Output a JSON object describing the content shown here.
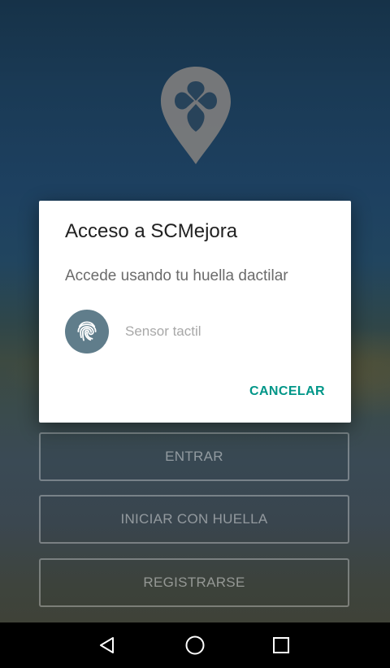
{
  "app": {
    "logo_icon": "location-pin-flower-icon"
  },
  "dialog": {
    "title": "Acceso a SCMejora",
    "description": "Accede usando tu huella dactilar",
    "sensor_icon": "fingerprint-icon",
    "sensor_label": "Sensor tactil",
    "cancel_label": "CANCELAR",
    "accent_color": "#009688",
    "icon_bg_color": "#607d8b"
  },
  "buttons": {
    "enter_label": "ENTRAR",
    "fingerprint_login_label": "INICIAR CON HUELLA",
    "register_label": "REGISTRARSE"
  },
  "navigation_bar": {
    "back_icon": "back-triangle-icon",
    "home_icon": "home-circle-icon",
    "recents_icon": "recents-square-icon"
  }
}
